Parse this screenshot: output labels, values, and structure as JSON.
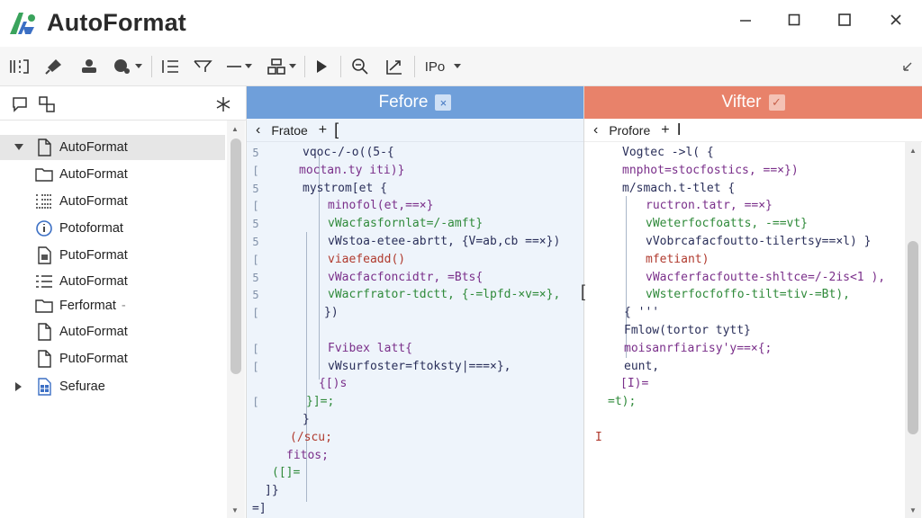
{
  "app": {
    "title": "AutoFormat",
    "window_buttons": [
      "minimize-icon",
      "maximize-icon",
      "close-icon"
    ]
  },
  "toolbar": {
    "view_label": "IPo",
    "icons": [
      "columns-icon",
      "brush-icon",
      "stamp-icon",
      "palette-icon",
      "list-icon",
      "merge-icon",
      "line-icon",
      "grid-icon",
      "play-icon",
      "inspect-icon",
      "chart-icon"
    ],
    "collapse_icon": "collapse-arrow-icon"
  },
  "sidebar": {
    "tools": [
      "comment-icon",
      "link-node-icon",
      "asterisk-icon"
    ],
    "items": [
      {
        "label": "AutoFormat",
        "icon": "document-icon",
        "expanded": true,
        "selected": true
      },
      {
        "label": "AutoFormat",
        "icon": "folder-icon"
      },
      {
        "label": "AutoFormat",
        "icon": "grid-list-icon"
      },
      {
        "label": "Potoformat",
        "icon": "info-icon"
      },
      {
        "label": "PutoFormat",
        "icon": "doc-image-icon"
      },
      {
        "label": "AutoFormat",
        "icon": "list-icon"
      },
      {
        "label": "Ferformat",
        "icon": "folder-icon",
        "suffix": "-"
      },
      {
        "label": "AutoFormat",
        "icon": "document-icon"
      },
      {
        "label": "PutoFormat",
        "icon": "document-icon"
      },
      {
        "label": "Sefurae",
        "icon": "spreadsheet-icon",
        "expanded": false
      }
    ]
  },
  "left_pane": {
    "title": "Fefore",
    "badge": "×",
    "sub_label": "Fratoe",
    "sub_plus": "+",
    "sub_bracket": "[",
    "lines": [
      {
        "text": "vqoc-/-o((5-{",
        "gutter": "5"
      },
      {
        "text": "moctan.ty iti)}",
        "gutter": "["
      },
      {
        "text": "mystrom[et {",
        "gutter": "5"
      },
      {
        "text": "minofol(et,==×}",
        "gutter": "["
      },
      {
        "text": "vWacfasfornlat=/-amft}",
        "gutter": "5"
      },
      {
        "text": "vWstoa-etee-abrtt, {V=ab,cb ==×})",
        "gutter": "5"
      },
      {
        "text": "viaefeadd()",
        "gutter": "["
      },
      {
        "text": "vWacfacfoncidtr, =Bts{",
        "gutter": "5"
      },
      {
        "text": "vWacrfrator-tdctt, {-=lpfd-×v=×},",
        "gutter": "5"
      },
      {
        "text": "})",
        "gutter": "["
      },
      {
        "text": "",
        "gutter": ""
      },
      {
        "text": "Fvibex latt{",
        "gutter": "["
      },
      {
        "text": "vWsurfoster=ftoksty|===×},",
        "gutter": "["
      },
      {
        "text": "{[)s",
        "gutter": ""
      },
      {
        "text": "}]=;",
        "gutter": "["
      },
      {
        "text": "}",
        "gutter": ""
      },
      {
        "text": "(/scu;",
        "gutter": ""
      },
      {
        "text": "fitos;",
        "gutter": ""
      },
      {
        "text": "([]=",
        "gutter": ""
      },
      {
        "text": "]}",
        "gutter": ""
      },
      {
        "text": "=]",
        "gutter": ""
      }
    ]
  },
  "right_pane": {
    "title": "Vifter",
    "badge": "✓",
    "sub_label": "Profore",
    "sub_plus": "+",
    "sub_bracket": "I",
    "lines": [
      {
        "text": "Vogtec ->l( {"
      },
      {
        "text": "mnphot=stocfostics, ==×})"
      },
      {
        "text": "m/smach.t-tlet {"
      },
      {
        "text": "ructron.tatr, ==×}"
      },
      {
        "text": "vWeterfocfoatts, -==vt}"
      },
      {
        "text": "vVobrcafacfoutto-tilertsy==×l) }"
      },
      {
        "text": "mfetiant)"
      },
      {
        "text": "vWacferfacfoutte-shltce=/-2is<1 ),"
      },
      {
        "text": "vWsterfocfoffo-tilt=tiv-=Bt),"
      },
      {
        "text": "{ '''"
      },
      {
        "text": "Fmlow(tortor tytt}"
      },
      {
        "text": "moisanrfiarisy'y==×{;"
      },
      {
        "text": "eunt,"
      },
      {
        "text": "[I)="
      },
      {
        "text": "=t);"
      },
      {
        "text": ""
      },
      {
        "text": "I"
      }
    ]
  },
  "colors": {
    "before_header": "#6f9fda",
    "after_header": "#e8826a",
    "logo_green": "#3aa35c",
    "logo_blue": "#3b6fc4"
  }
}
